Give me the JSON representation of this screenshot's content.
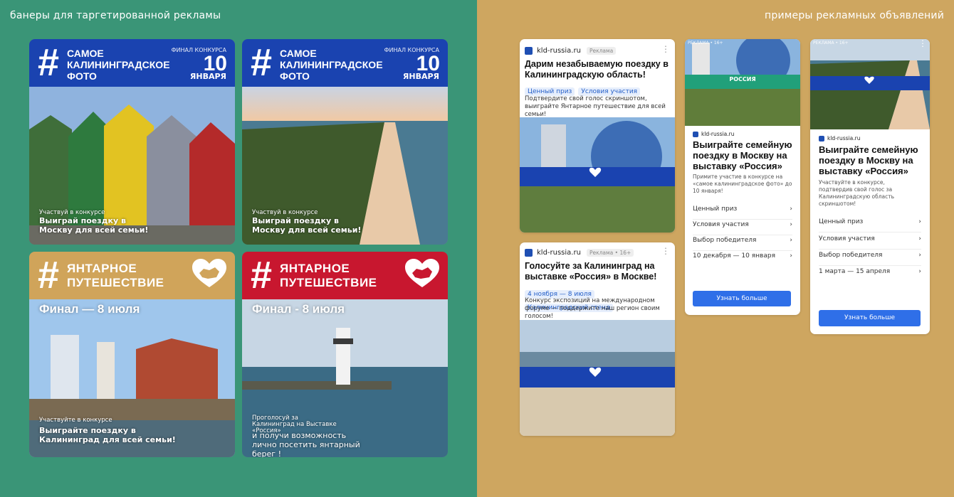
{
  "left_title": "банеры для таргетированной рекламы",
  "right_title": "примеры рекламных объявлений",
  "colors": {
    "green_bg": "#3a9577",
    "tan_bg": "#cea660",
    "blue": "#1a43b0",
    "gold": "#d0a45a",
    "red": "#c8172f"
  },
  "banners": [
    {
      "title": "самое калининградское фото",
      "final_label": "Финал конкурса",
      "final_day": "10",
      "final_month": "января",
      "cap_small": "Участвуй в конкурсе",
      "cap_big": "Выиграй поездку в Москву для всей семьи!"
    },
    {
      "title": "самое калининградское фото",
      "final_label": "Финал конкурса",
      "final_day": "10",
      "final_month": "января",
      "cap_small": "Участвуй в конкурсе",
      "cap_big": "Выиграй поездку в Москву для всей семьи!"
    },
    {
      "title": "янтарное путешествие",
      "final": "Финал — 8 июля",
      "cap_small": "Участвуйте в конкурсе",
      "cap_big": "Выиграйте поездку в Калининград для всей семьи!"
    },
    {
      "title": "янтарное путешествие",
      "final": "Финал - 8 июля",
      "cap_small": "Проголосуй за Калининград на Выставке «Россия»",
      "cap_big": "и получи возможность лично посетить янтарный берег !"
    }
  ],
  "ads": {
    "a1": {
      "site": "kld-russia.ru",
      "tag": "Реклама",
      "title": "Дарим незабываемую поездку в Калининградскую область!",
      "chips": [
        "Ценный приз",
        "Условия участия"
      ],
      "desc": "Подтвердите свой голос скриншотом, выиграйте Янтарное путешествие для всей семьи!"
    },
    "a2": {
      "site": "kld-russia.ru",
      "tag": "Реклама • 16+",
      "title": "Голосуйте за Калининград на выставке «Россия» в Москве!",
      "chips": [
        "4 ноября — 8 июля",
        "Калининградский стенд"
      ],
      "desc": "Конкурс экспозиций на международном форуме — поддержите наш регион своим голосом!"
    },
    "a3": {
      "top_tag": "РЕКЛАМА • 16+",
      "site": "kld-russia.ru",
      "title": "Выиграйте семейную поездку в Москву на выставку «Россия»",
      "desc": "Примите участие в конкурсе на «самое калининградское фото» до 10 января!",
      "rows": [
        "Ценный приз",
        "Условия участия",
        "Выбор победителя",
        "10 декабря — 10 января"
      ],
      "cta": "Узнать больше",
      "logo": "РОССИЯ"
    },
    "a4": {
      "top_tag": "РЕКЛАМА • 16+",
      "site": "kld-russia.ru",
      "title": "Выиграйте семейную поездку в Москву на выставку «Россия»",
      "desc": "Участвуйте в конкурсе, подтвердив свой голос за Калининградскую область скриншотом!",
      "rows": [
        "Ценный приз",
        "Условия участия",
        "Выбор победителя",
        "1 марта — 15 апреля"
      ],
      "cta": "Узнать больше"
    }
  },
  "icons": {
    "hash": "#",
    "chevron": "›",
    "menu": "⋮"
  }
}
